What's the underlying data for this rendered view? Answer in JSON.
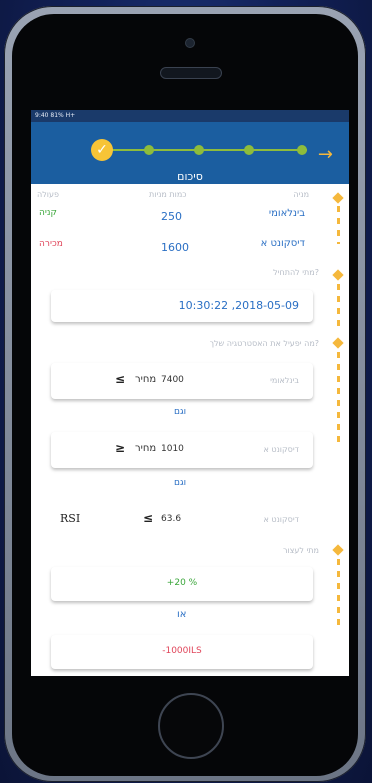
{
  "status_bar": {
    "text": "9:40  81%  H+"
  },
  "header": {
    "title": "סיכום",
    "back_icon": "arrow-right-icon",
    "completed_icon": "check-icon"
  },
  "summary": {
    "columns": {
      "action": "פעולה",
      "quantity": "כמות מניות",
      "stock": "מניה"
    },
    "rows": [
      {
        "action": "קניה",
        "action_color": "#3aa63a",
        "quantity": "250",
        "stock": "בינלאומי"
      },
      {
        "action": "מכירה",
        "action_color": "#e0455a",
        "quantity": "1600",
        "stock": "דיסקונט א"
      }
    ]
  },
  "start": {
    "question": "מתי להתחיל?",
    "datetime": "10:30:22 ,2018-05-09"
  },
  "strategy": {
    "question": "מה יפעיל את האסטרטגיה שלך?",
    "conditions": [
      {
        "stock": "בינלאומי",
        "operator": "≤",
        "field": "מחיר",
        "value": "7400"
      },
      {
        "stock": "דיסקונט א",
        "operator": "≥",
        "field": "מחיר",
        "value": "1010"
      },
      {
        "stock": "דיסקונט א",
        "operator": "≤",
        "field": "RSI",
        "value": "63.6"
      }
    ],
    "joiner": "וגם"
  },
  "stop": {
    "question": "מתי לעצור",
    "profit": "+20 %",
    "or_label": "או",
    "loss": "-1000ILS",
    "profit_color": "#3aa63a",
    "loss_color": "#e0455a"
  },
  "colors": {
    "header": "#1b5ea0",
    "accent": "#f5b83c",
    "link": "#2a6fc4"
  }
}
